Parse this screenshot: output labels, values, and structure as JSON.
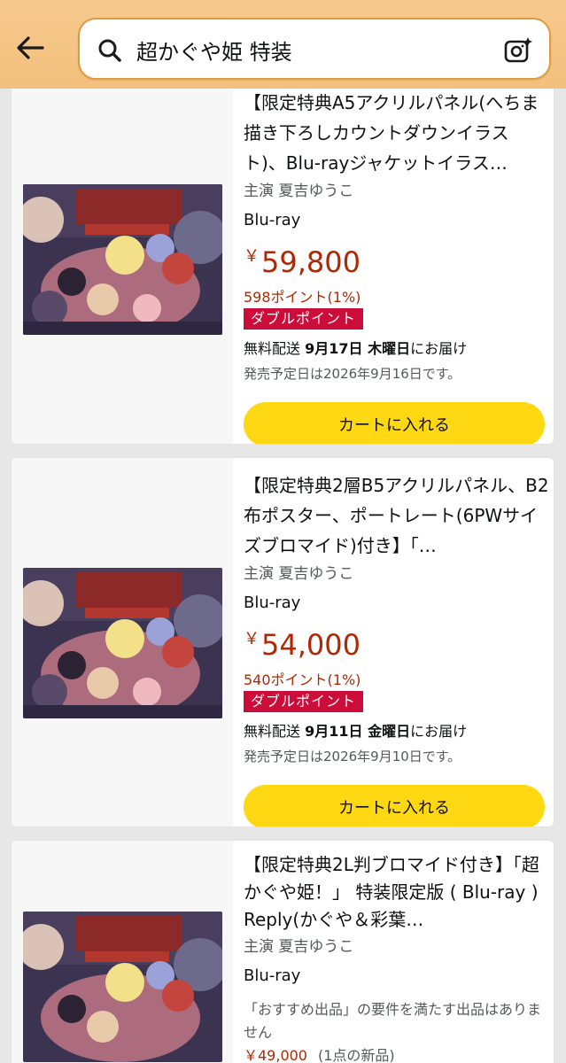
{
  "search": {
    "query": "超かぐや姫 特装",
    "back_icon": "arrow-left-icon",
    "search_icon": "magnifier-icon",
    "camera_icon": "camera-sparkle-icon"
  },
  "colors": {
    "header": "#f3c07c",
    "price": "#b12704",
    "badge": "#cc0c39",
    "cart": "#ffd814"
  },
  "products": [
    {
      "title": "【限定特典A5アクリルパネル(へちま描き下ろしカウントダウンイラスト)、Blu-rayジャケットイラス…",
      "actor": "主演 夏吉ゆうこ",
      "format": "Blu-ray",
      "price_symbol": "￥",
      "price": "59,800",
      "points": "598ポイント(1%)",
      "badge": "ダブルポイント",
      "delivery_prefix": "無料配送 ",
      "delivery_date": "9月17日 木曜日",
      "delivery_suffix": "にお届け",
      "release": "発売予定日は2026年9月16日です。",
      "cart_label": "カートに入れる"
    },
    {
      "title": "【限定特典2層B5アクリルパネル、B2布ポスター、ポートレート(6PWサイズブロマイド)付き】「…",
      "actor": "主演 夏吉ゆうこ",
      "format": "Blu-ray",
      "price_symbol": "￥",
      "price": "54,000",
      "points": "540ポイント(1%)",
      "badge": "ダブルポイント",
      "delivery_prefix": "無料配送 ",
      "delivery_date": "9月11日 金曜日",
      "delivery_suffix": "にお届け",
      "release": "発売予定日は2026年9月10日です。",
      "cart_label": "カートに入れる"
    },
    {
      "title": "【限定特典2L判ブロマイド付き】「超かぐや姫！」 特装限定版 ( Blu-ray ) Reply(かぐや＆彩葉…",
      "actor": "主演 夏吉ゆうこ",
      "format": "Blu-ray",
      "note": "「おすすめ出品」の要件を満たす出品はありません",
      "sub_price": "￥49,000",
      "sub_condition": "(1点の新品)"
    }
  ]
}
